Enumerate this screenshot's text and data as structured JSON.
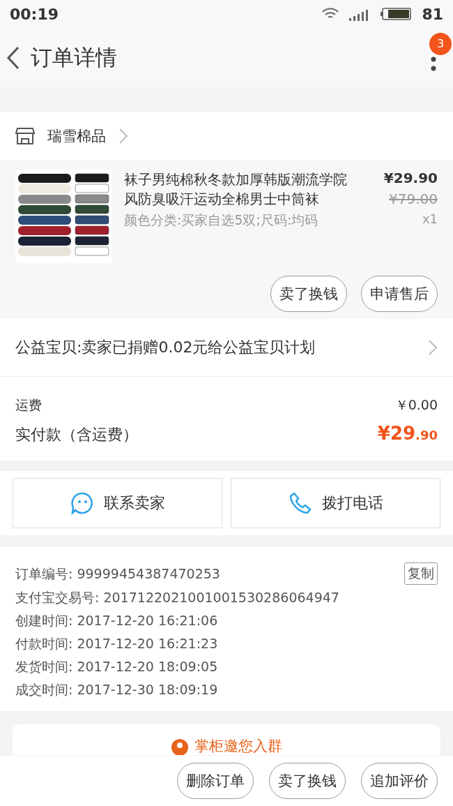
{
  "status_bar": {
    "time": "00:19",
    "battery": "81"
  },
  "header": {
    "title": "订单详情",
    "badge": "3"
  },
  "shop": {
    "name": "瑞雪棉品"
  },
  "product": {
    "title": "袜子男纯棉秋冬款加厚韩版潮流学院风防臭吸汗运动全棉男士中筒袜",
    "sku": "颜色分类:买家自选5双;尺码:均码",
    "price": "¥29.90",
    "original_price": "¥79.00",
    "quantity": "x1",
    "actions": [
      "卖了换钱",
      "申请售后"
    ]
  },
  "charity": {
    "text": "公益宝贝:卖家已捐赠0.02元给公益宝贝计划"
  },
  "fees": [
    {
      "label": "运费",
      "value": "￥0.00",
      "kind": "plain"
    },
    {
      "label": "实付款（含运费）",
      "value": "¥29",
      "cents": ".90",
      "kind": "total"
    }
  ],
  "contact": [
    {
      "label": "联系卖家",
      "kind": "chat"
    },
    {
      "label": "拨打电话",
      "kind": "phone"
    }
  ],
  "order_info": {
    "copy": "复制",
    "rows": [
      "订单编号: 99999454387470253",
      "支付宝交易号: 2017122021001001530286064947",
      "创建时间: 2017-12-20 16:21:06",
      "付款时间: 2017-12-20 16:21:23",
      "发货时间: 2017-12-20 18:09:05",
      "成交时间: 2017-12-30 18:09:19"
    ]
  },
  "group_invite": {
    "text": "掌柜邀您入群"
  },
  "bottom_actions": [
    "删除订单",
    "卖了换钱",
    "追加评价"
  ]
}
